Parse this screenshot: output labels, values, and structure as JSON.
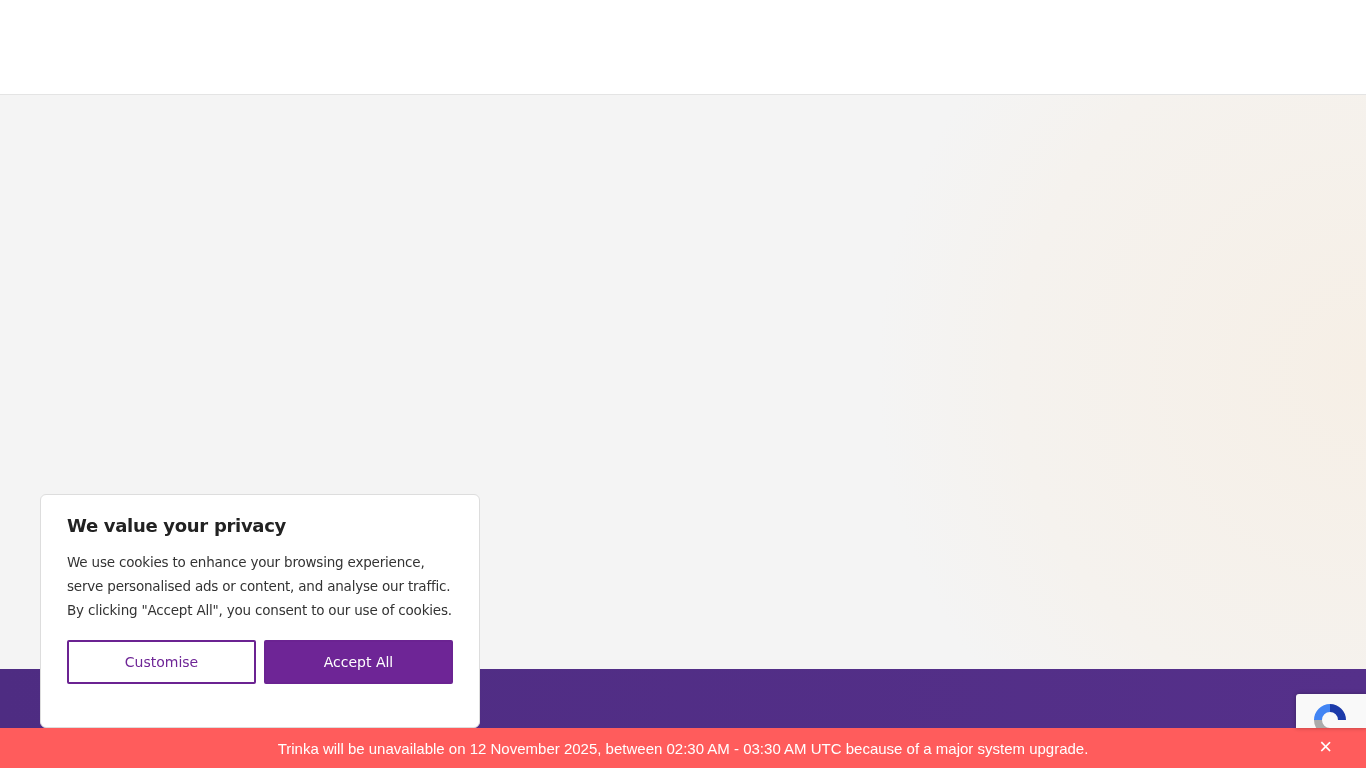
{
  "cookie_banner": {
    "title": "We value your privacy",
    "message": "We use cookies to enhance your browsing experience, serve personalised ads or content, and analyse our traffic. By clicking \"Accept All\", you consent to our use of cookies.",
    "buttons": [
      {
        "label": "Customise",
        "kind": "outline"
      },
      {
        "label": "Accept All",
        "kind": "filled"
      }
    ]
  },
  "notice_bar": {
    "message": "Trinka will be unavailable on 12 November 2025, between 02:30 AM - 03:30 AM UTC because of a major system upgrade.",
    "close": "×"
  }
}
